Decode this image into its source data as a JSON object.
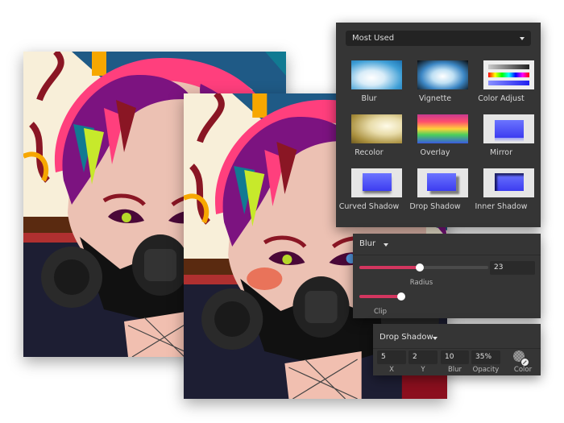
{
  "effects_panel": {
    "category": "Most Used",
    "effects": [
      {
        "label": "Blur",
        "icon": "blur-thumbnail"
      },
      {
        "label": "Vignette",
        "icon": "vignette-thumbnail"
      },
      {
        "label": "Color Adjust",
        "icon": "color-adjust-thumbnail"
      },
      {
        "label": "Recolor",
        "icon": "recolor-thumbnail"
      },
      {
        "label": "Overlay",
        "icon": "overlay-thumbnail"
      },
      {
        "label": "Mirror",
        "icon": "mirror-thumbnail"
      },
      {
        "label": "Curved Shadow",
        "icon": "curved-shadow-thumbnail"
      },
      {
        "label": "Drop Shadow",
        "icon": "drop-shadow-thumbnail"
      },
      {
        "label": "Inner Shadow",
        "icon": "inner-shadow-thumbnail"
      }
    ]
  },
  "blur_panel": {
    "title": "Blur",
    "radius": {
      "label": "Radius",
      "value": "23",
      "fraction": 0.47
    },
    "clip": {
      "label": "Clip",
      "fraction": 1.0
    }
  },
  "drop_shadow_panel": {
    "title": "Drop Shadow",
    "fields": [
      {
        "label": "X",
        "value": "5"
      },
      {
        "label": "Y",
        "value": "2"
      },
      {
        "label": "Blur",
        "value": "10"
      },
      {
        "label": "Opacity",
        "value": "35%"
      }
    ],
    "color_label": "Color"
  },
  "colors": {
    "panel_bg": "#353535",
    "accent": "#d3365f"
  }
}
